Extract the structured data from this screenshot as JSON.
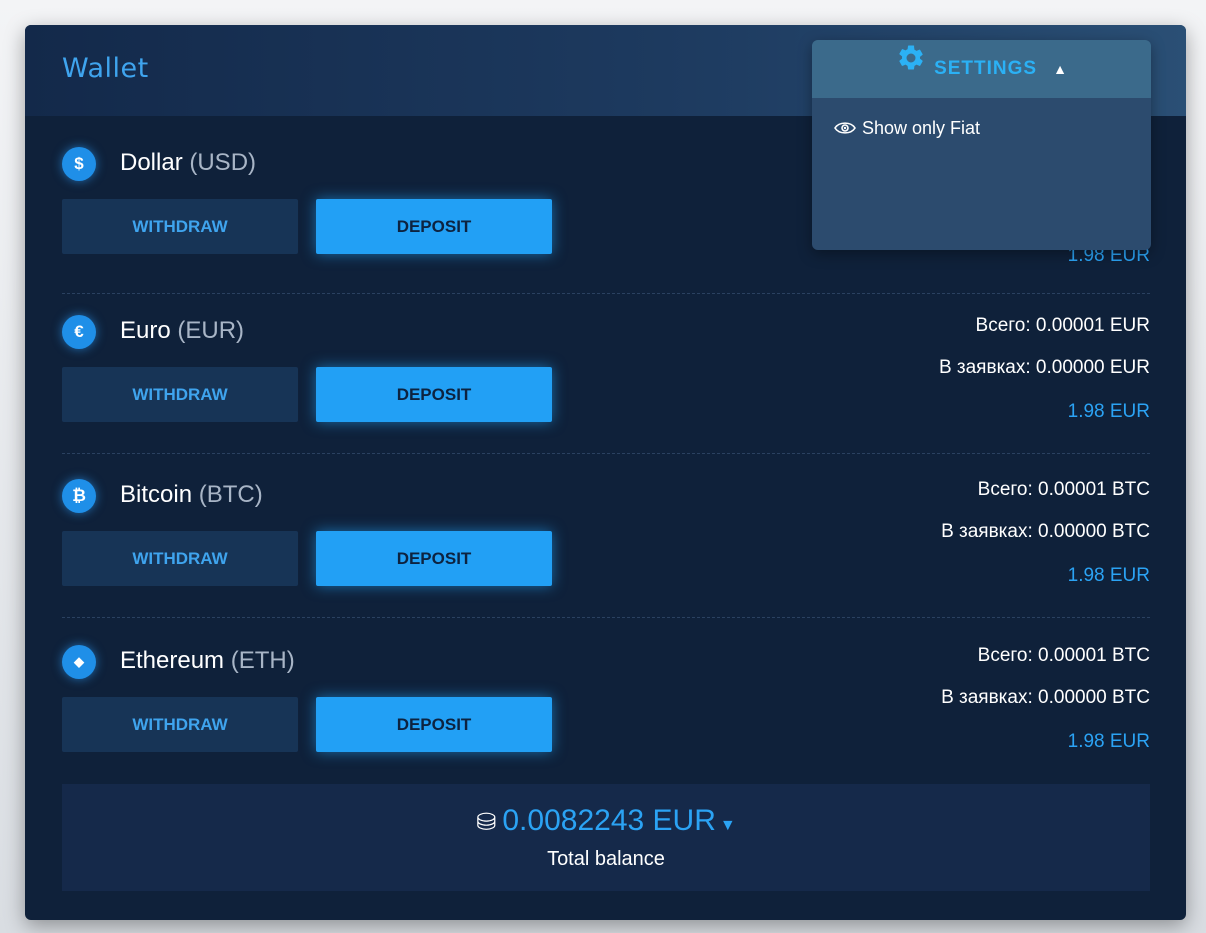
{
  "wallet": {
    "title": "Wallet"
  },
  "settings": {
    "label": "SETTINGS",
    "menu_items": [
      {
        "label": "Show only Fiat",
        "icon": "eye-icon"
      }
    ]
  },
  "currencies": [
    {
      "name": "Dollar",
      "code": "(USD)",
      "icon_glyph": "$",
      "withdraw_label": "WITHDRAW",
      "deposit_label": "DEPOSIT",
      "total": "",
      "in_orders": "",
      "fiat": "1.98 EUR"
    },
    {
      "name": "Euro",
      "code": "(EUR)",
      "icon_glyph": "€",
      "withdraw_label": "WITHDRAW",
      "deposit_label": "DEPOSIT",
      "total": "Всего: 0.00001 EUR",
      "in_orders": "В заявках: 0.00000 EUR",
      "fiat": "1.98 EUR"
    },
    {
      "name": "Bitcoin",
      "code": "(BTC)",
      "icon_glyph": "₿",
      "withdraw_label": "WITHDRAW",
      "deposit_label": "DEPOSIT",
      "total": "Всего: 0.00001 BTC",
      "in_orders": "В заявках: 0.00000 BTC",
      "fiat": "1.98 EUR"
    },
    {
      "name": "Ethereum",
      "code": "(ETH)",
      "icon_glyph": "◆",
      "withdraw_label": "WITHDRAW",
      "deposit_label": "DEPOSIT",
      "total": "Всего: 0.00001 BTC",
      "in_orders": "В заявках: 0.00000 BTC",
      "fiat": "1.98 EUR"
    }
  ],
  "total_balance": {
    "amount": "0.0082243 EUR",
    "label": "Total balance",
    "icon": "coins-icon"
  },
  "colors": {
    "accent": "#22a0f5",
    "card_bg": "#0f213a",
    "settings_bg": "#2c4b6e"
  }
}
